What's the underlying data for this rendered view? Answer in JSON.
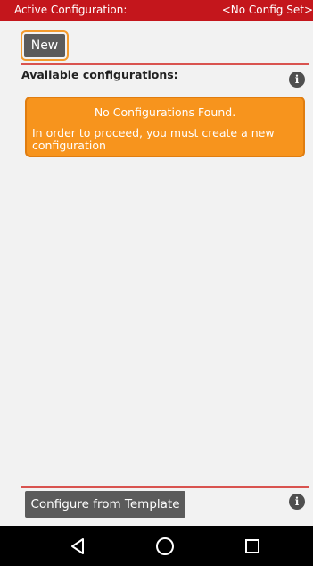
{
  "header": {
    "active_label": "Active Configuration:",
    "active_value": "<No Config Set>"
  },
  "toolbar": {
    "new_label": "New"
  },
  "configs": {
    "available_label": "Available configurations:",
    "empty_title": "No Configurations Found.",
    "empty_message": "In order to proceed, you must create a new configuration"
  },
  "footer": {
    "template_button_label": "Configure from Template"
  },
  "icons": {
    "info": "info-icon",
    "back": "back-icon",
    "home": "home-icon",
    "recent": "recent-apps-icon"
  },
  "colors": {
    "header_bg": "#c4161c",
    "notice_bg": "#f7941d",
    "button_bg": "#5b5b5b",
    "highlight": "#f39a2c"
  }
}
